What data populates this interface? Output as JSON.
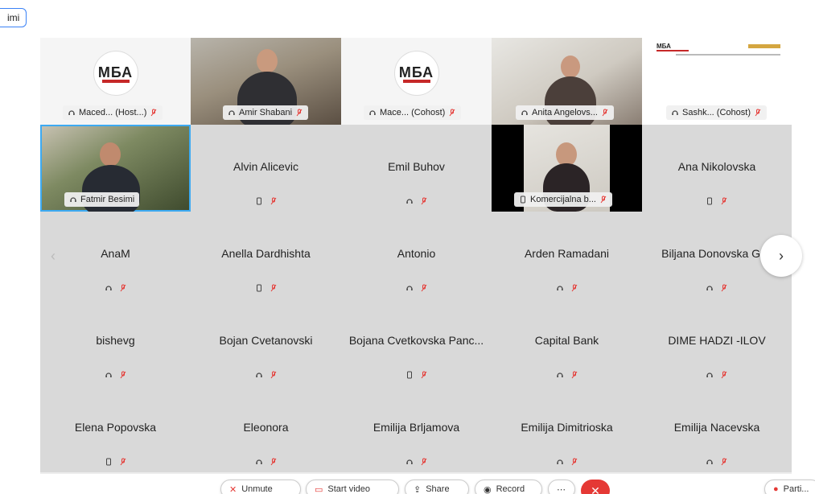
{
  "corner_badge": "imi",
  "video_row": [
    {
      "label": "Maced... (Host...)",
      "kind": "logo",
      "logo_text": "МБА"
    },
    {
      "label": "Amir Shabani",
      "kind": "office"
    },
    {
      "label": "Mace... (Cohost)",
      "kind": "logo",
      "logo_text": "МБА"
    },
    {
      "label": "Anita Angelovs...",
      "kind": "room"
    },
    {
      "label": "Sashk... (Cohost)",
      "kind": "doc",
      "logo_text": "МБА"
    }
  ],
  "row2": [
    {
      "label": "Fatmir Besimi",
      "kind": "plants",
      "active": true
    },
    {
      "name": "Alvin Alicevic",
      "device": "phone"
    },
    {
      "name": "Emil Buhov",
      "device": "headset"
    },
    {
      "label": "Komercijalna b...",
      "kind": "dark",
      "device": "phone"
    },
    {
      "name": "Ana Nikolovska",
      "device": "phone"
    }
  ],
  "rows": [
    [
      {
        "name": "AnaM",
        "device": "headset"
      },
      {
        "name": "Anella Dardhishta",
        "device": "phone"
      },
      {
        "name": "Antonio",
        "device": "headset"
      },
      {
        "name": "Arden Ramadani",
        "device": "headset"
      },
      {
        "name": "Biljana Donovska Gec",
        "device": "headset"
      }
    ],
    [
      {
        "name": "bishevg",
        "device": "headset"
      },
      {
        "name": "Bojan Cvetanovski",
        "device": "headset"
      },
      {
        "name": "Bojana Cvetkovska Panc...",
        "device": "phone"
      },
      {
        "name": "Capital Bank",
        "device": "headset"
      },
      {
        "name": "DIME HADZI -ILOV",
        "device": "headset"
      }
    ],
    [
      {
        "name": "Elena Popovska",
        "device": "phone"
      },
      {
        "name": "Eleonora",
        "device": "headset"
      },
      {
        "name": "Emilija Brljamova",
        "device": "headset"
      },
      {
        "name": "Emilija Dimitrioska",
        "device": "headset"
      },
      {
        "name": "Emilija Nacevska",
        "device": "headset"
      }
    ]
  ],
  "nav": {
    "left": "‹",
    "right": "›"
  },
  "toolbar": {
    "unmute": "Unmute",
    "start_video": "Start video",
    "share": "Share",
    "record": "Record",
    "end": "✕",
    "right_label": "Parti..."
  },
  "colors": {
    "active_border": "#3daaf2",
    "mic_muted": "#e53935",
    "end_button": "#e53935"
  }
}
